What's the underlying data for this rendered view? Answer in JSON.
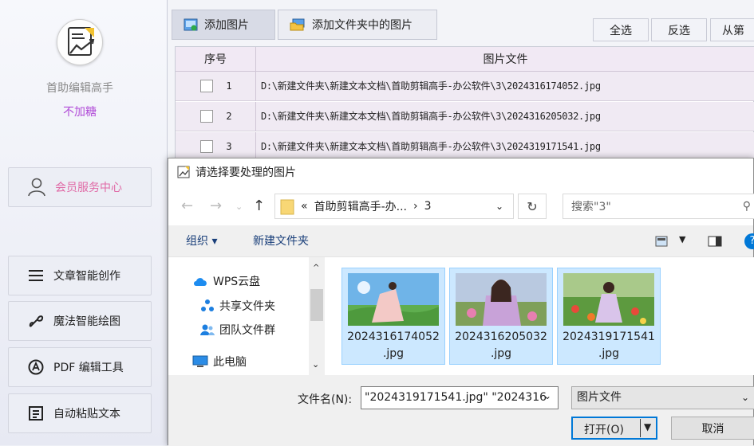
{
  "sidebar": {
    "app_name": "首助编辑高手",
    "tagline": "不加糖",
    "member_label": "会员服务中心",
    "nav": [
      {
        "label": "文章智能创作",
        "icon": "menu-lines-icon"
      },
      {
        "label": "魔法智能绘图",
        "icon": "magic-wand-icon"
      },
      {
        "label": "PDF 编辑工具",
        "icon": "pdf-icon"
      },
      {
        "label": "自动粘贴文本",
        "icon": "paste-icon"
      }
    ]
  },
  "toolbar": {
    "add_image": "添加图片",
    "add_folder_images": "添加文件夹中的图片",
    "select_all": "全选",
    "invert_select": "反选",
    "from": "从第"
  },
  "table": {
    "headers": [
      "序号",
      "图片文件"
    ],
    "rows": [
      {
        "num": "1",
        "path": "D:\\新建文件夹\\新建文本文档\\首助剪辑高手-办公软件\\3\\2024316174052.jpg"
      },
      {
        "num": "2",
        "path": "D:\\新建文件夹\\新建文本文档\\首助剪辑高手-办公软件\\3\\2024316205032.jpg"
      },
      {
        "num": "3",
        "path": "D:\\新建文件夹\\新建文本文档\\首助剪辑高手-办公软件\\3\\2024319171541.jpg"
      }
    ]
  },
  "dialog": {
    "title": "请选择要处理的图片",
    "address": {
      "prefix": "«",
      "parent": "首助剪辑高手-办...",
      "current": "3"
    },
    "search_placeholder": "搜索\"3\"",
    "organize": "组织 ▾",
    "new_folder": "新建文件夹",
    "nav_items": [
      {
        "label": "WPS云盘",
        "icon": "cloud-icon"
      },
      {
        "label": "共享文件夹",
        "icon": "share-icon"
      },
      {
        "label": "团队文件群",
        "icon": "team-icon"
      },
      {
        "label": "此电脑",
        "icon": "computer-icon"
      }
    ],
    "files": [
      {
        "line1": "2024316174052",
        "line2": ".jpg"
      },
      {
        "line1": "2024316205032",
        "line2": ".jpg"
      },
      {
        "line1": "2024319171541",
        "line2": ".jpg"
      }
    ],
    "filename_label": "文件名(N):",
    "filename_value": "\"2024319171541.jpg\" \"2024316",
    "filetype": "图片文件",
    "open_label": "打开(O)",
    "cancel_label": "取消"
  },
  "colors": {
    "member_text": "#e06aa6",
    "tagline": "#b14bd8",
    "selection": "#cce8ff",
    "primary_border": "#0078d7"
  }
}
